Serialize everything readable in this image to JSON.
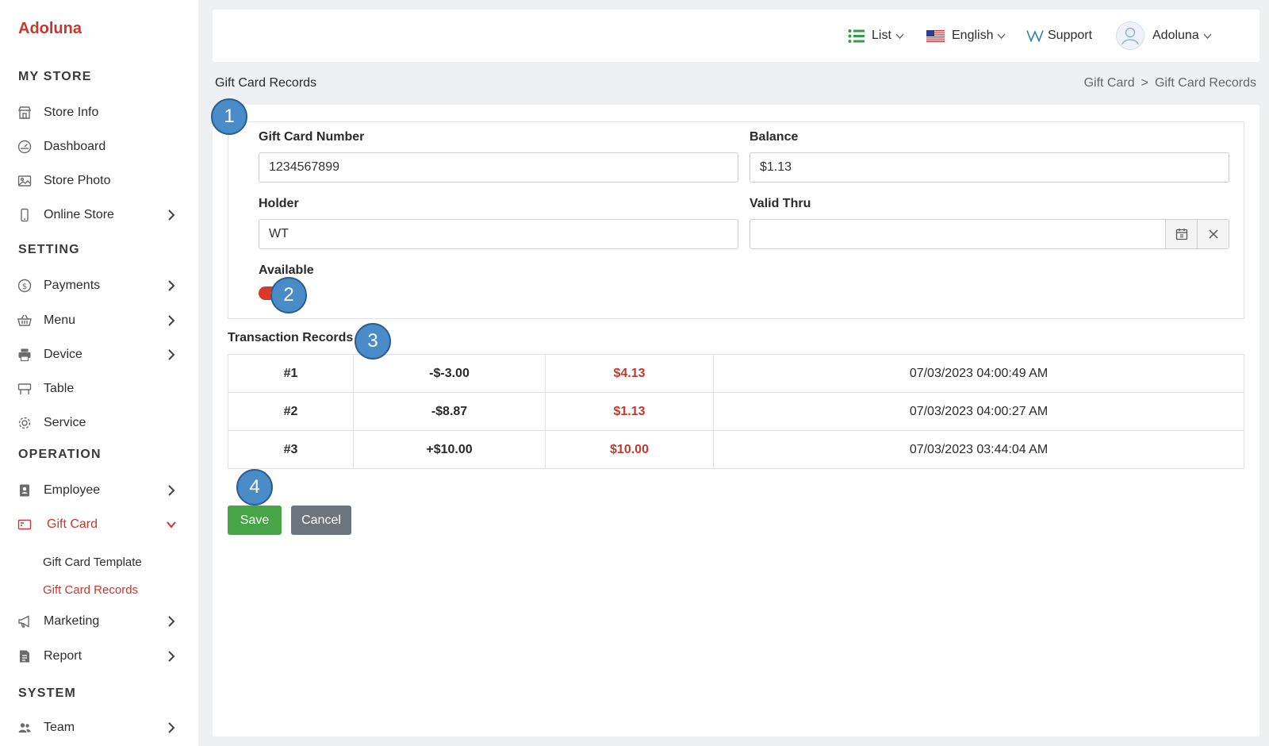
{
  "app": {
    "brand": "Adoluna"
  },
  "sidebar": {
    "sections": {
      "my_store": "MY STORE",
      "setting": "SETTING",
      "operation": "OPERATION",
      "system": "SYSTEM"
    },
    "items": {
      "store_info": "Store Info",
      "dashboard": "Dashboard",
      "store_photo": "Store Photo",
      "online_store": "Online Store",
      "payments": "Payments",
      "menu": "Menu",
      "device": "Device",
      "table": "Table",
      "service": "Service",
      "employee": "Employee",
      "gift_card": "Gift Card",
      "gift_card_template": "Gift Card Template",
      "gift_card_records": "Gift Card Records",
      "marketing": "Marketing",
      "report": "Report",
      "team": "Team"
    },
    "accent_color": "#c9372c"
  },
  "topbar": {
    "list_label": "List",
    "language_label": "English",
    "support_label": "Support",
    "user_label": "Adoluna"
  },
  "page": {
    "title": "Gift Card Records",
    "breadcrumb": {
      "parent": "Gift Card",
      "separator": ">",
      "current": "Gift Card Records"
    }
  },
  "form": {
    "gift_card_number_label": "Gift Card Number",
    "gift_card_number_value": "1234567899",
    "balance_label": "Balance",
    "balance_value": "$1.13",
    "holder_label": "Holder",
    "holder_value": "WT",
    "valid_thru_label": "Valid Thru",
    "valid_thru_value": "",
    "available_label": "Available",
    "available_on": true
  },
  "transactions": {
    "heading": "Transaction Records",
    "rows": [
      {
        "id": "#1",
        "amount": "-$-3.00",
        "balance": "$4.13",
        "date": "07/03/2023 04:00:49 AM"
      },
      {
        "id": "#2",
        "amount": "-$8.87",
        "balance": "$1.13",
        "date": "07/03/2023 04:00:27 AM"
      },
      {
        "id": "#3",
        "amount": "+$10.00",
        "balance": "$10.00",
        "date": "07/03/2023 03:44:04 AM"
      }
    ]
  },
  "actions": {
    "save_label": "Save",
    "cancel_label": "Cancel"
  },
  "badges": {
    "b1": "1",
    "b2": "2",
    "b3": "3",
    "b4": "4"
  },
  "colors": {
    "save_button": "#47a447",
    "cancel_button": "#6c757d",
    "badge": "#4a8cc8",
    "toggle_on": "#d8392b"
  }
}
